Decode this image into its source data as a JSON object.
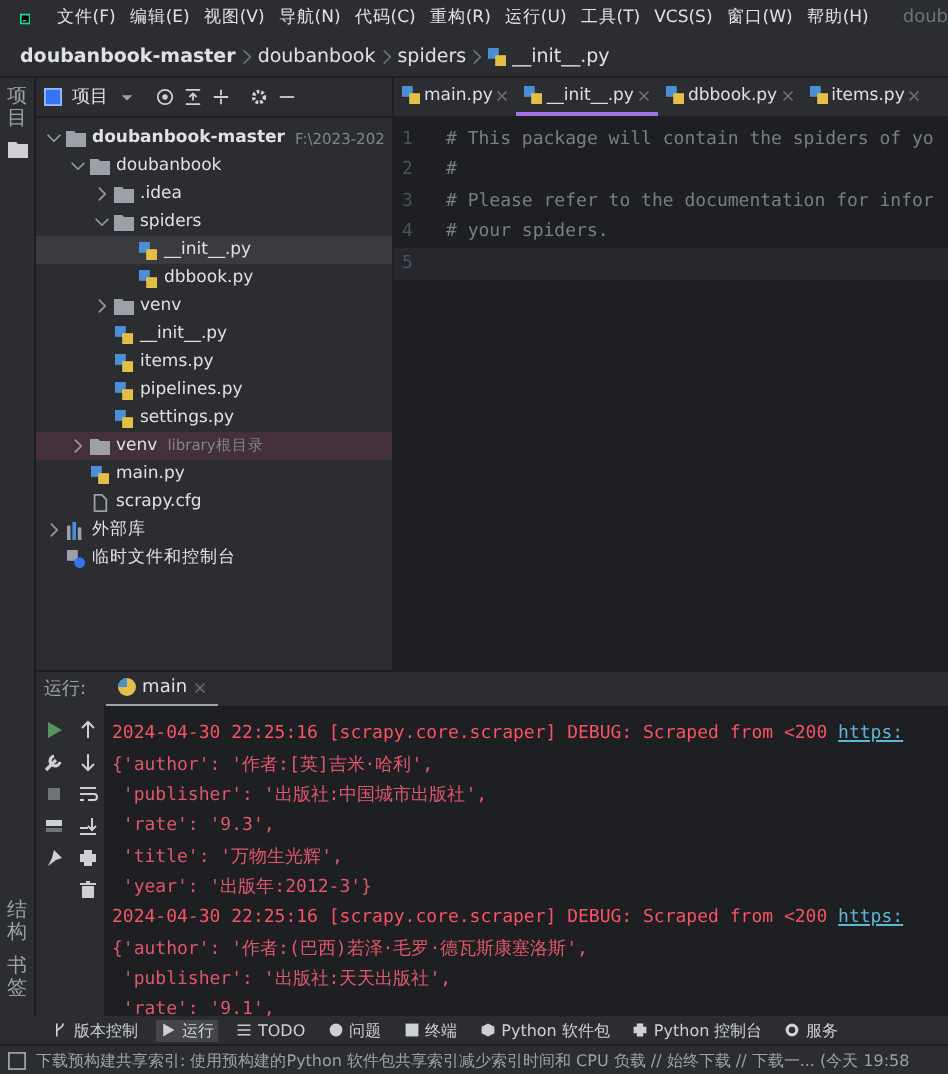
{
  "menu_bar": {
    "items": [
      "文件(F)",
      "编辑(E)",
      "视图(V)",
      "导航(N)",
      "代码(C)",
      "重构(R)",
      "运行(U)",
      "工具(T)",
      "VCS(S)",
      "窗口(W)",
      "帮助(H)"
    ],
    "window_title": "doub"
  },
  "breadcrumbs": [
    "doubanbook-master",
    "doubanbook",
    "spiders",
    "__init__.py"
  ],
  "side_strip": {
    "top": [
      "项目"
    ],
    "bottom": [
      "结构",
      "书签"
    ]
  },
  "project_panel": {
    "title": "项目",
    "tree": [
      {
        "label": "doubanbook-master",
        "kind": "folder",
        "bold": true,
        "hint": "F:\\2023-202",
        "expanded": true,
        "selected": false,
        "children": [
          {
            "label": "doubanbook",
            "kind": "folder",
            "bold": false,
            "expanded": true,
            "selected": false,
            "children": [
              {
                "label": ".idea",
                "kind": "folder",
                "bold": false,
                "expanded": false,
                "selected": false
              },
              {
                "label": "spiders",
                "kind": "folder",
                "bold": false,
                "expanded": true,
                "selected": false,
                "children": [
                  {
                    "label": "__init__.py",
                    "kind": "python",
                    "bold": false,
                    "selected": true
                  },
                  {
                    "label": "dbbook.py",
                    "kind": "python",
                    "bold": false,
                    "selected": false
                  }
                ]
              },
              {
                "label": "venv",
                "kind": "folder",
                "bold": false,
                "expanded": false,
                "selected": false
              },
              {
                "label": "__init__.py",
                "kind": "python",
                "bold": false,
                "selected": false
              },
              {
                "label": "items.py",
                "kind": "python",
                "bold": false,
                "selected": false
              },
              {
                "label": "pipelines.py",
                "kind": "python",
                "bold": false,
                "selected": false
              },
              {
                "label": "settings.py",
                "kind": "python",
                "bold": false,
                "selected": false
              }
            ]
          },
          {
            "label": "venv",
            "kind": "library-root",
            "bold": false,
            "hint": "library根目录",
            "expanded": false,
            "selected": false
          },
          {
            "label": "main.py",
            "kind": "python",
            "bold": false,
            "selected": false
          },
          {
            "label": "scrapy.cfg",
            "kind": "config",
            "bold": false,
            "selected": false
          }
        ]
      },
      {
        "label": "外部库",
        "kind": "external-libs",
        "bold": false,
        "expanded": false,
        "selected": false
      },
      {
        "label": "临时文件和控制台",
        "kind": "scratches",
        "bold": false,
        "selected": false
      }
    ]
  },
  "editor": {
    "tabs": [
      {
        "label": "main.py",
        "selected": false
      },
      {
        "label": "__init__.py",
        "selected": true
      },
      {
        "label": "dbbook.py",
        "selected": false
      },
      {
        "label": "items.py",
        "selected": false
      }
    ],
    "lines": [
      {
        "number": "1",
        "text": "# This package will contain the spiders of yo",
        "current": false
      },
      {
        "number": "2",
        "text": "#",
        "current": false
      },
      {
        "number": "3",
        "text": "# Please refer to the documentation for infor",
        "current": false
      },
      {
        "number": "4",
        "text": "# your spiders.",
        "current": false
      },
      {
        "number": "5",
        "current": true
      }
    ]
  },
  "run_panel": {
    "label": "运行:",
    "tabs": [
      {
        "label": "main",
        "selected": true
      }
    ],
    "output": [
      {
        "kind": "log",
        "text": "2024-04-30 22:25:16 [scrapy.core.scraper] DEBUG: Scraped from <200 ",
        "link": "https:"
      },
      {
        "kind": "data",
        "text": "{'author': '作者:[英]吉米·哈利',"
      },
      {
        "kind": "data",
        "text": " 'publisher': '出版社:中国城市出版社',"
      },
      {
        "kind": "data",
        "text": " 'rate': '9.3',"
      },
      {
        "kind": "data",
        "text": " 'title': '万物生光辉',"
      },
      {
        "kind": "data",
        "text": " 'year': '出版年:2012-3'}"
      },
      {
        "kind": "log",
        "text": "2024-04-30 22:25:16 [scrapy.core.scraper] DEBUG: Scraped from <200 ",
        "link": "https:"
      },
      {
        "kind": "data",
        "text": "{'author': '作者:(巴西)若泽·毛罗·德瓦斯康塞洛斯',"
      },
      {
        "kind": "data",
        "text": " 'publisher': '出版社:天天出版社',"
      },
      {
        "kind": "data",
        "text": " 'rate': '9.1',"
      }
    ]
  },
  "tool_windows": [
    {
      "label": "版本控制",
      "selected": false
    },
    {
      "label": "运行",
      "selected": true
    },
    {
      "label": "TODO",
      "selected": false
    },
    {
      "label": "问题",
      "selected": false
    },
    {
      "label": "终端",
      "selected": false
    },
    {
      "label": "Python 软件包",
      "selected": false
    },
    {
      "label": "Python 控制台",
      "selected": false
    },
    {
      "label": "服务",
      "selected": false
    }
  ],
  "status_bar": {
    "text": "下载预构建共享索引: 使用预构建的Python 软件包共享索引减少索引时间和 CPU 负载 // 始终下载 // 下载一... (今天 19:58"
  }
}
